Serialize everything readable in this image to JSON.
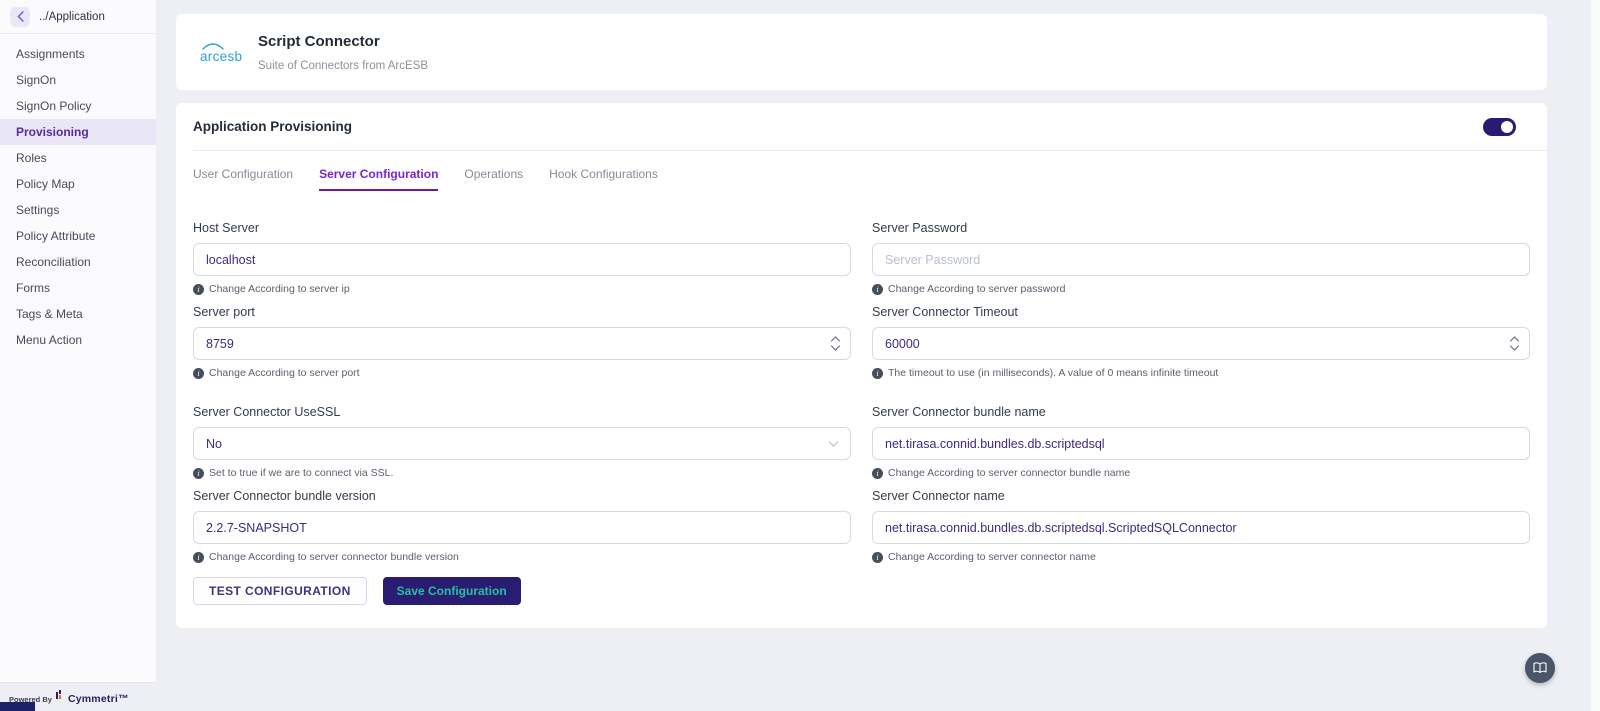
{
  "sidebar": {
    "back_label": "../Application",
    "items": [
      {
        "label": "Assignments"
      },
      {
        "label": "SignOn"
      },
      {
        "label": "SignOn Policy"
      },
      {
        "label": "Provisioning",
        "active": true
      },
      {
        "label": "Roles"
      },
      {
        "label": "Policy Map"
      },
      {
        "label": "Settings"
      },
      {
        "label": "Policy Attribute"
      },
      {
        "label": "Reconciliation"
      },
      {
        "label": "Forms"
      },
      {
        "label": "Tags & Meta"
      },
      {
        "label": "Menu Action"
      }
    ]
  },
  "footer": {
    "powered_by": "Powered By",
    "brand": "Cymmetri™"
  },
  "header": {
    "logo_text": "arcesb",
    "title": "Script Connector",
    "subtitle": "Suite of Connectors from ArcESB"
  },
  "provisioning": {
    "title": "Application Provisioning",
    "toggle_on": true,
    "tabs": [
      {
        "label": "User Configuration"
      },
      {
        "label": "Server Configuration",
        "active": true
      },
      {
        "label": "Operations"
      },
      {
        "label": "Hook Configurations"
      }
    ],
    "fields": [
      {
        "label": "Host Server",
        "value": "localhost",
        "placeholder": "",
        "helper": "Change According to server ip",
        "type": "text"
      },
      {
        "label": "Server Password",
        "value": "",
        "placeholder": "Server Password",
        "helper": "Change According to server password",
        "type": "text"
      },
      {
        "label": "Server port",
        "value": "8759",
        "placeholder": "",
        "helper": "Change According to server port",
        "type": "number"
      },
      {
        "label": "Server Connector Timeout",
        "value": "60000",
        "placeholder": "",
        "helper": "The timeout to use (in milliseconds). A value of 0 means infinite timeout",
        "type": "number"
      },
      {
        "label": "Server Connector UseSSL",
        "value": "No",
        "placeholder": "",
        "helper": "Set to true if we are to connect via SSL.",
        "type": "select"
      },
      {
        "label": "Server Connector bundle name",
        "value": "net.tirasa.connid.bundles.db.scriptedsql",
        "placeholder": "",
        "helper": "Change According to server connector bundle name",
        "type": "text"
      },
      {
        "label": "Server Connector bundle version",
        "value": "2.2.7-SNAPSHOT",
        "placeholder": "",
        "helper": "Change According to server connector bundle version",
        "type": "text"
      },
      {
        "label": "Server Connector name",
        "value": "net.tirasa.connid.bundles.db.scriptedsql.ScriptedSQLConnector",
        "placeholder": "",
        "helper": "Change According to server connector name",
        "type": "text"
      }
    ],
    "actions": {
      "test": "TEST CONFIGURATION",
      "save": "Save Configuration"
    }
  },
  "colors": {
    "accent_purple": "#7b24cf",
    "active_nav_purple": "#5b2a9b",
    "indigo_dark": "#2a1c70",
    "teal_button_text": "#27c0a2",
    "input_value_purple": "#40297f",
    "logo_blue": "#2e9fd8",
    "page_background": "#edeff4",
    "fab_slate": "#4b5569"
  }
}
